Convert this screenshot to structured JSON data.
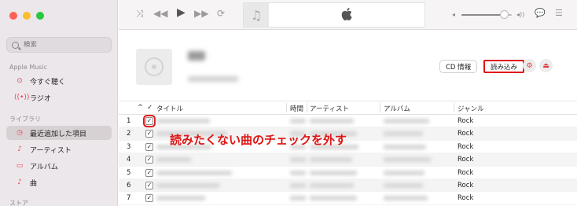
{
  "sidebar": {
    "search_placeholder": "検索",
    "sections": [
      {
        "label": "Apple Music",
        "items": [
          {
            "label": "今すぐ聴く",
            "icon": "play-circle-icon"
          },
          {
            "label": "ラジオ",
            "icon": "radio-waves-icon"
          }
        ]
      },
      {
        "label": "ライブラリ",
        "items": [
          {
            "label": "最近追加した項目",
            "icon": "clock-icon",
            "active": true
          },
          {
            "label": "アーティスト",
            "icon": "microphone-icon"
          },
          {
            "label": "アルバム",
            "icon": "album-icon"
          },
          {
            "label": "曲",
            "icon": "music-note-icon"
          }
        ]
      },
      {
        "label": "ストア",
        "items": []
      }
    ]
  },
  "header": {
    "cd_info_label": "CD 情報",
    "import_label": "読み込み"
  },
  "volume": {
    "level": 0.85
  },
  "table": {
    "columns": {
      "sort": "^",
      "check": "✓",
      "title": "タイトル",
      "time": "時間",
      "artist": "アーティスト",
      "album": "アルバム",
      "genre": "ジャンル"
    },
    "rows": [
      {
        "num": "1",
        "checked": "✓",
        "genre": "Rock"
      },
      {
        "num": "2",
        "checked": "✓",
        "genre": "Rock"
      },
      {
        "num": "3",
        "checked": "✓",
        "genre": "Rock"
      },
      {
        "num": "4",
        "checked": "✓",
        "genre": "Rock"
      },
      {
        "num": "5",
        "checked": "✓",
        "genre": "Rock"
      },
      {
        "num": "6",
        "checked": "✓",
        "genre": "Rock"
      },
      {
        "num": "7",
        "checked": "✓",
        "genre": "Rock"
      }
    ]
  },
  "annotation": "読みたくない曲のチェックを外す",
  "colors": {
    "accent": "#f0425a",
    "highlight": "#e01414"
  }
}
